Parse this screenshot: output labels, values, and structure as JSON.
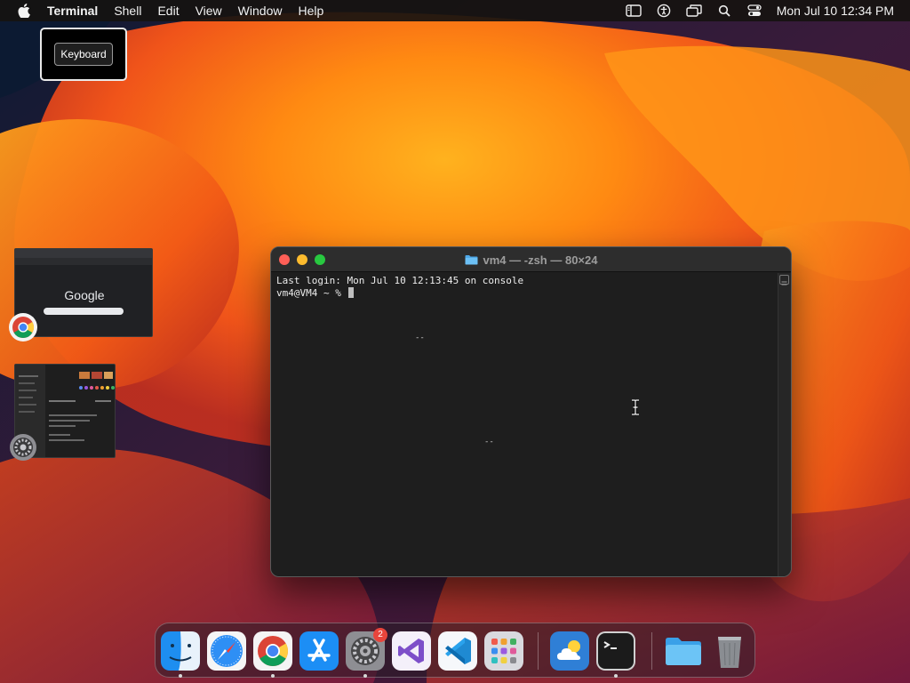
{
  "menubar": {
    "app_name": "Terminal",
    "items": [
      "Shell",
      "Edit",
      "View",
      "Window",
      "Help"
    ],
    "status_icons": [
      "list-icon",
      "accessibility-icon",
      "screen-mirroring-icon",
      "search-icon",
      "control-center-icon"
    ],
    "clock": "Mon Jul 10  12:34 PM"
  },
  "keyboard_overlay": {
    "label": "Keyboard"
  },
  "stage_manager": {
    "windows": [
      {
        "app": "chrome-icon",
        "preview_text": "Google"
      },
      {
        "app": "system-settings-icon"
      }
    ]
  },
  "terminal": {
    "title": "vm4 — -zsh — 80×24",
    "lines": [
      "Last login: Mon Jul 10 12:13:45 on console",
      "vm4@VM4 ~ % "
    ],
    "stray_marks": [
      "--",
      "--"
    ]
  },
  "dock": {
    "apps": [
      {
        "name": "finder-icon",
        "running": true
      },
      {
        "name": "safari-icon",
        "running": false
      },
      {
        "name": "chrome-icon",
        "running": true
      },
      {
        "name": "app-store-icon",
        "running": false
      },
      {
        "name": "system-settings-icon",
        "running": true,
        "badge": "2"
      },
      {
        "name": "visual-studio-icon",
        "running": false
      },
      {
        "name": "vscode-icon",
        "running": false
      },
      {
        "name": "launchpad-icon",
        "running": false
      },
      {
        "name": "weather-icon",
        "running": false
      },
      {
        "name": "terminal-icon",
        "running": true
      },
      {
        "name": "folder-icon",
        "running": false
      },
      {
        "name": "trash-icon",
        "running": false
      }
    ]
  },
  "colors": {
    "close": "#ff5f57",
    "minimize": "#febc2e",
    "maximize": "#28c840",
    "terminal_bg": "#1e1e1e",
    "badge": "#e8453c"
  }
}
